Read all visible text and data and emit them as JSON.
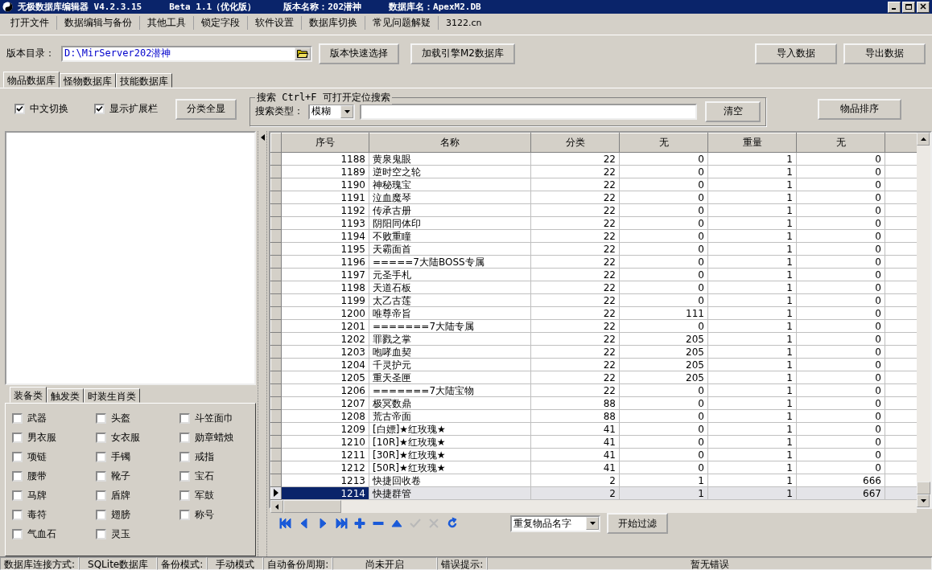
{
  "window": {
    "title_parts": [
      "无极数据库编辑器 V4.2.3.15",
      "Beta 1.1（优化版）",
      "版本名称：202潜神",
      "数据库名：ApexM2.DB"
    ]
  },
  "menu": [
    "打开文件",
    "数据编辑与备份",
    "其他工具",
    "锁定字段",
    "软件设置",
    "数据库切换",
    "常见问题解疑",
    "3122.cn"
  ],
  "toolbar": {
    "dir_label": "版本目录：",
    "dir_value": "D:\\MirServer202潜神",
    "buttons": [
      "版本快速选择",
      "加载引擎M2数据库"
    ],
    "right_buttons": [
      "导入数据",
      "导出数据"
    ]
  },
  "tabs": [
    {
      "label": "物品数据库",
      "selected": true
    },
    {
      "label": "怪物数据库",
      "selected": false
    },
    {
      "label": "技能数据库",
      "selected": false
    }
  ],
  "options": [
    {
      "label": "中文切换",
      "checked": true
    },
    {
      "label": "显示扩展栏",
      "checked": true
    }
  ],
  "show_all_button": "分类全显",
  "search": {
    "title": "搜索  Ctrl+F 可打开定位搜索",
    "type_label": "搜索类型：",
    "type_value": "模糊",
    "clear_button": "清空"
  },
  "sort_button": "物品排序",
  "category_tabs": [
    {
      "label": "装备类",
      "selected": true
    },
    {
      "label": "触发类",
      "selected": false
    },
    {
      "label": "时装生肖类",
      "selected": false
    }
  ],
  "categories": [
    {
      "label": "武器",
      "checked": false
    },
    {
      "label": "头盔",
      "checked": false
    },
    {
      "label": "斗笠面巾",
      "checked": false
    },
    {
      "label": "男衣服",
      "checked": false
    },
    {
      "label": "女衣服",
      "checked": false
    },
    {
      "label": "勋章蜡烛",
      "checked": false
    },
    {
      "label": "项链",
      "checked": false
    },
    {
      "label": "手镯",
      "checked": false
    },
    {
      "label": "戒指",
      "checked": false
    },
    {
      "label": "腰带",
      "checked": false
    },
    {
      "label": "靴子",
      "checked": false
    },
    {
      "label": "宝石",
      "checked": false
    },
    {
      "label": "马牌",
      "checked": false
    },
    {
      "label": "盾牌",
      "checked": false
    },
    {
      "label": "军鼓",
      "checked": false
    },
    {
      "label": "毒符",
      "checked": false
    },
    {
      "label": "翅膀",
      "checked": false
    },
    {
      "label": "称号",
      "checked": false
    },
    {
      "label": "气血石",
      "checked": false
    },
    {
      "label": "灵玉",
      "checked": false
    }
  ],
  "table": {
    "columns": [
      "序号",
      "名称",
      "分类",
      "无",
      "重量",
      "无"
    ],
    "rows": [
      {
        "cells": [
          "1188",
          "黄泉鬼眼",
          "22",
          "0",
          "1",
          "0"
        ],
        "selected": false
      },
      {
        "cells": [
          "1189",
          "逆时空之轮",
          "22",
          "0",
          "1",
          "0"
        ],
        "selected": false
      },
      {
        "cells": [
          "1190",
          "神秘瑰宝",
          "22",
          "0",
          "1",
          "0"
        ],
        "selected": false
      },
      {
        "cells": [
          "1191",
          "泣血魔琴",
          "22",
          "0",
          "1",
          "0"
        ],
        "selected": false
      },
      {
        "cells": [
          "1192",
          "传承古册",
          "22",
          "0",
          "1",
          "0"
        ],
        "selected": false
      },
      {
        "cells": [
          "1193",
          "阴阳同体印",
          "22",
          "0",
          "1",
          "0"
        ],
        "selected": false
      },
      {
        "cells": [
          "1194",
          "不败重瞳",
          "22",
          "0",
          "1",
          "0"
        ],
        "selected": false
      },
      {
        "cells": [
          "1195",
          "天霸面首",
          "22",
          "0",
          "1",
          "0"
        ],
        "selected": false
      },
      {
        "cells": [
          "1196",
          "=====7大陆BOSS专属",
          "22",
          "0",
          "1",
          "0"
        ],
        "selected": false
      },
      {
        "cells": [
          "1197",
          "元圣手札",
          "22",
          "0",
          "1",
          "0"
        ],
        "selected": false
      },
      {
        "cells": [
          "1198",
          "天道石板",
          "22",
          "0",
          "1",
          "0"
        ],
        "selected": false
      },
      {
        "cells": [
          "1199",
          "太乙古莲",
          "22",
          "0",
          "1",
          "0"
        ],
        "selected": false
      },
      {
        "cells": [
          "1200",
          "唯尊帝旨",
          "22",
          "111",
          "1",
          "0"
        ],
        "selected": false
      },
      {
        "cells": [
          "1201",
          "=======7大陆专属",
          "22",
          "0",
          "1",
          "0"
        ],
        "selected": false
      },
      {
        "cells": [
          "1202",
          "罪戮之掌",
          "22",
          "205",
          "1",
          "0"
        ],
        "selected": false
      },
      {
        "cells": [
          "1203",
          "咆哮血契",
          "22",
          "205",
          "1",
          "0"
        ],
        "selected": false
      },
      {
        "cells": [
          "1204",
          "千灵护元",
          "22",
          "205",
          "1",
          "0"
        ],
        "selected": false
      },
      {
        "cells": [
          "1205",
          "重天圣匣",
          "22",
          "205",
          "1",
          "0"
        ],
        "selected": false
      },
      {
        "cells": [
          "1206",
          "=======7大陆宝物",
          "22",
          "0",
          "1",
          "0"
        ],
        "selected": false
      },
      {
        "cells": [
          "1207",
          "极冥数鼎",
          "88",
          "0",
          "1",
          "0"
        ],
        "selected": false
      },
      {
        "cells": [
          "1208",
          "荒古帝面",
          "88",
          "0",
          "1",
          "0"
        ],
        "selected": false
      },
      {
        "cells": [
          "1209",
          "[白嫖]★红玫瑰★",
          "41",
          "0",
          "1",
          "0"
        ],
        "selected": false
      },
      {
        "cells": [
          "1210",
          "[10R]★红玫瑰★",
          "41",
          "0",
          "1",
          "0"
        ],
        "selected": false
      },
      {
        "cells": [
          "1211",
          "[30R]★红玫瑰★",
          "41",
          "0",
          "1",
          "0"
        ],
        "selected": false
      },
      {
        "cells": [
          "1212",
          "[50R]★红玫瑰★",
          "41",
          "0",
          "1",
          "0"
        ],
        "selected": false
      },
      {
        "cells": [
          "1213",
          "快捷回收卷",
          "2",
          "1",
          "1",
          "666"
        ],
        "selected": false
      },
      {
        "cells": [
          "1214",
          "快捷群管",
          "2",
          "1",
          "1",
          "667"
        ],
        "selected": true
      }
    ]
  },
  "navigator": [
    {
      "kind": "first",
      "disabled": false
    },
    {
      "kind": "prior",
      "disabled": false
    },
    {
      "kind": "next",
      "disabled": false
    },
    {
      "kind": "last",
      "disabled": false
    },
    {
      "kind": "insert",
      "disabled": false
    },
    {
      "kind": "delete",
      "disabled": false
    },
    {
      "kind": "edit",
      "disabled": false
    },
    {
      "kind": "post",
      "disabled": true
    },
    {
      "kind": "cancel",
      "disabled": true
    },
    {
      "kind": "refresh",
      "disabled": false
    }
  ],
  "filter": {
    "value": "重复物品名字",
    "button": "开始过滤"
  },
  "status_bar": [
    {
      "label": "数据库连接方式:",
      "value": "SQLite数据库"
    },
    {
      "label": "备份模式:",
      "value": "手动模式"
    },
    {
      "label": "自动备份周期:",
      "value": "尚未开启"
    },
    {
      "label": "错误提示:",
      "value": "暂无错误"
    }
  ]
}
